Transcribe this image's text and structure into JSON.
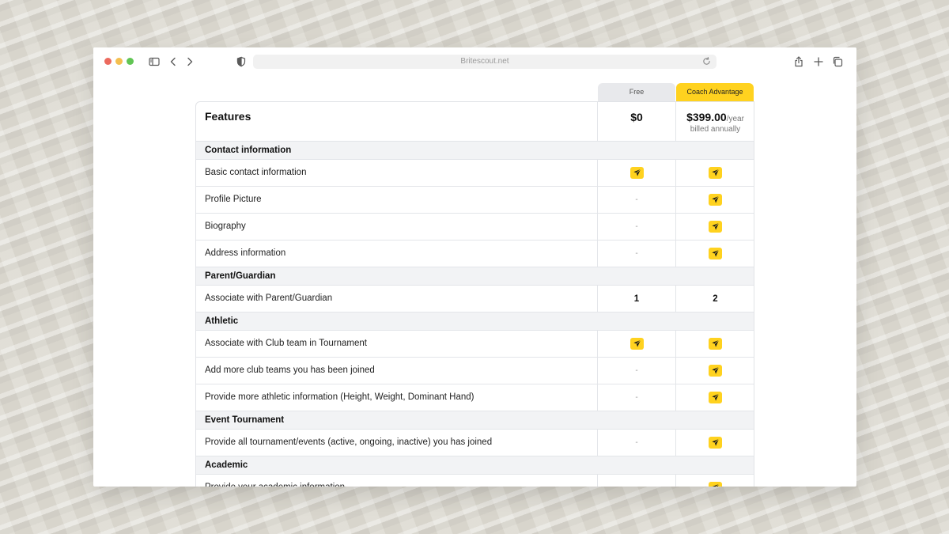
{
  "browser": {
    "url": "Britescout.net"
  },
  "plans": {
    "free": {
      "name": "Free",
      "price": "$0"
    },
    "coach": {
      "name": "Coach Advantage",
      "price": "$399.00",
      "period": "/year",
      "billing": "billed annually"
    }
  },
  "table": {
    "header_label": "Features",
    "sections": [
      {
        "title": "Contact information",
        "features": [
          {
            "label": "Basic contact information",
            "free": "check",
            "coach": "check"
          },
          {
            "label": "Profile Picture",
            "free": "-",
            "coach": "check"
          },
          {
            "label": "Biography",
            "free": "-",
            "coach": "check"
          },
          {
            "label": "Address information",
            "free": "-",
            "coach": "check"
          }
        ]
      },
      {
        "title": "Parent/Guardian",
        "features": [
          {
            "label": "Associate with Parent/Guardian",
            "free": "1",
            "coach": "2"
          }
        ]
      },
      {
        "title": "Athletic",
        "features": [
          {
            "label": "Associate with Club team in Tournament",
            "free": "check",
            "coach": "check"
          },
          {
            "label": "Add more club teams you has been joined",
            "free": "-",
            "coach": "check"
          },
          {
            "label": "Provide more athletic information (Height, Weight, Dominant Hand)",
            "free": "-",
            "coach": "check"
          }
        ]
      },
      {
        "title": "Event Tournament",
        "features": [
          {
            "label": "Provide all tournament/events  (active, ongoing, inactive) you has joined",
            "free": "-",
            "coach": "check"
          }
        ]
      },
      {
        "title": "Academic",
        "features": [
          {
            "label": "Provide your academic information",
            "free": "-",
            "coach": "check"
          }
        ]
      }
    ]
  },
  "colors": {
    "accent": "#ffd21f",
    "free_tab": "#e8e9ec",
    "section_bg": "#f2f3f5"
  },
  "icons": {
    "check": "britescout-arrow-icon"
  }
}
